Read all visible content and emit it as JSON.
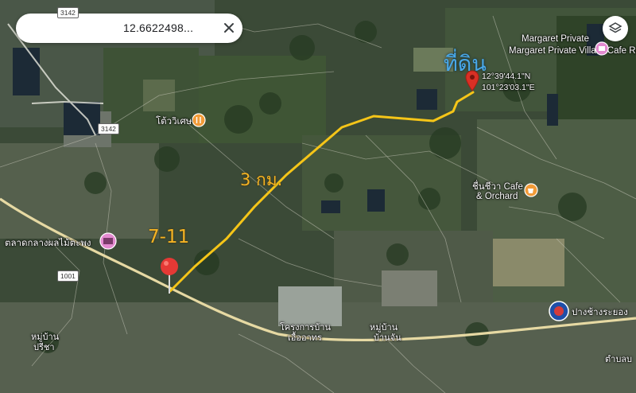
{
  "search": {
    "query": "12.6622498...",
    "close_icon": "close-icon"
  },
  "layers_icon": "layers-icon",
  "destination": {
    "overlay_label": "ที่ดิน",
    "coord_lat": "12°39'44.1\"N",
    "coord_lon": "101°23'03.1\"E",
    "pin_color": "#d93025"
  },
  "origin": {
    "overlay_label": "7-11",
    "pin_color": "#e53935"
  },
  "route": {
    "distance_label": "3 กม.",
    "color": "#f5c518"
  },
  "pois": {
    "villa": "Margaret Private Villa & Cafe Rayong",
    "tovises": "โต้ววิเศษ",
    "cafe_line1": "ชื่นชีวา Cafe",
    "cafe_line2": "& Orchard",
    "market": "ตลาดกลางผลไม้ตะพง",
    "elephant": "ปางช้างระยอง"
  },
  "places": {
    "project_line1": "โครงการบ้าน",
    "project_line2": "เอื้ออาทร",
    "village_line1": "หมู่บ้าน",
    "village_line2": "บ้านจัน",
    "preecha_line1": "หมู่บ้าน",
    "preecha_line2": "ปรีชา",
    "tambon": "ตำบลบ"
  },
  "roads": {
    "r3142_top": "3142",
    "r3142": "3142",
    "r1001": "1001"
  },
  "colors": {
    "route": "#f5c518",
    "overlay_text": "#f5b324",
    "destination_text": "#49a8e8",
    "cafe_poi": "#f29b38",
    "shop_poi": "#e38ad0"
  }
}
